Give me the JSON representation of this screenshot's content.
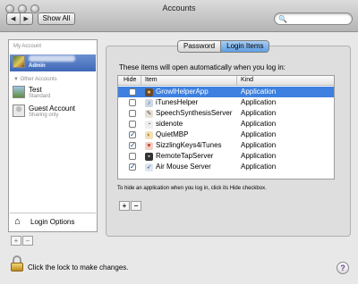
{
  "window": {
    "title": "Accounts"
  },
  "toolbar": {
    "back": "◀",
    "forward": "▶",
    "show_all": "Show All",
    "search_placeholder": "",
    "search_icon": "🔍"
  },
  "sidebar": {
    "my_account_label": "My Account",
    "my_account": {
      "role": "Admin",
      "icon": "user-picture-icon"
    },
    "other_accounts_label": "▼ Other Accounts",
    "other_accounts": [
      {
        "name": "Test",
        "role": "Standard",
        "icon": "user-picture-icon"
      },
      {
        "name": "Guest Account",
        "role": "Sharing only",
        "icon": "guest-user-icon"
      }
    ],
    "login_options": "Login Options",
    "add": "+",
    "remove": "−"
  },
  "tabs": [
    {
      "label": "Password"
    },
    {
      "label": "Login Items"
    }
  ],
  "login_items": {
    "info": "These items will open automatically when you log in:",
    "columns": {
      "hide": "Hide",
      "item": "Item",
      "kind": "Kind"
    },
    "rows": [
      {
        "hide": false,
        "name": "GrowlHelperApp",
        "kind": "Application",
        "selected": true
      },
      {
        "hide": false,
        "name": "iTunesHelper",
        "kind": "Application",
        "selected": false
      },
      {
        "hide": false,
        "name": "SpeechSynthesisServer",
        "kind": "Application",
        "selected": false
      },
      {
        "hide": false,
        "name": "sidenote",
        "kind": "Application",
        "selected": false
      },
      {
        "hide": true,
        "name": "QuietMBP",
        "kind": "Application",
        "selected": false
      },
      {
        "hide": true,
        "name": "SizzlingKeys4iTunes",
        "kind": "Application",
        "selected": false
      },
      {
        "hide": false,
        "name": "RemoteTapServer",
        "kind": "Application",
        "selected": false
      },
      {
        "hide": true,
        "name": "Air Mouse Server",
        "kind": "Application",
        "selected": false
      }
    ],
    "hint": "To hide an application when you log in, click its Hide checkbox.",
    "add": "+",
    "remove": "−"
  },
  "footer": {
    "lock_text": "Click the lock to make changes.",
    "help": "?"
  }
}
